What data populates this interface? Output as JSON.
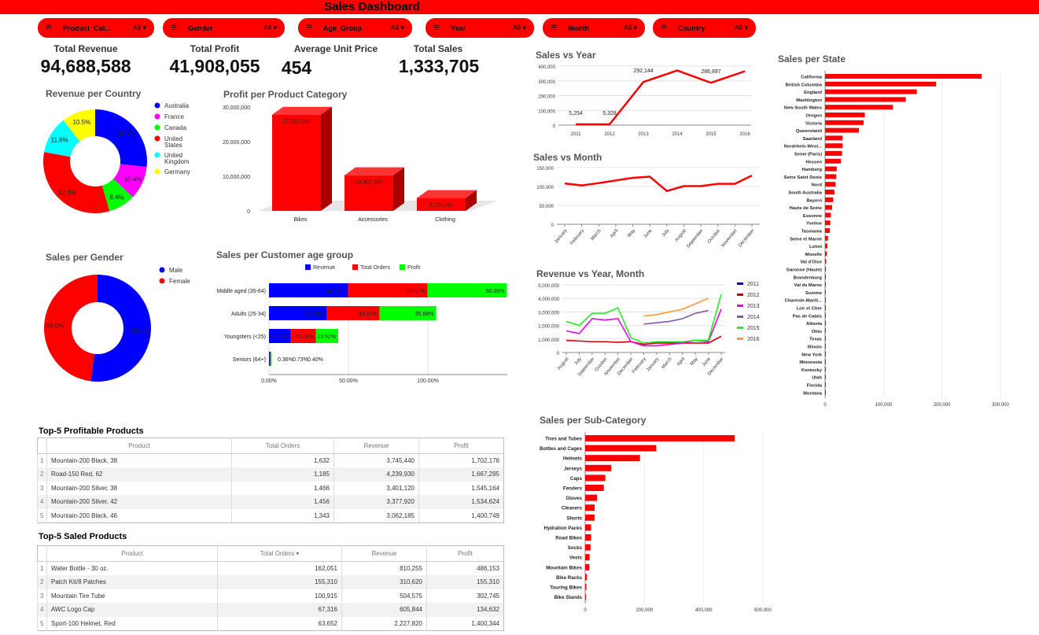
{
  "header": {
    "title": "Sales Dashboard"
  },
  "filters": [
    {
      "name": "Product_Cat...",
      "value": "All"
    },
    {
      "name": "Gender",
      "value": "All"
    },
    {
      "name": "Age_Group",
      "value": "All"
    },
    {
      "name": "Year",
      "value": "All"
    },
    {
      "name": "Month",
      "value": "All"
    },
    {
      "name": "Country",
      "value": "All"
    }
  ],
  "kpis": [
    {
      "label": "Total Revenue",
      "value": "94,688,588"
    },
    {
      "label": "Total Profit",
      "value": "41,908,055"
    },
    {
      "label": "Average Unit Price",
      "value": "454"
    },
    {
      "label": "Total Sales",
      "value": "1,333,705"
    }
  ],
  "sections": {
    "revenue_country": "Revenue per Country",
    "profit_category": "Profit per Product Category",
    "sales_gender": "Sales per Gender",
    "sales_age": "Sales per Customer age group",
    "sales_year": "Sales vs Year",
    "sales_month": "Sales vs Month",
    "rev_year_month": "Revenue vs Year, Month",
    "sales_state": "Sales per State",
    "sales_subcat": "Sales per Sub-Category",
    "top_profitable": "Top-5 Profitable Products",
    "top_saled": "Top-5 Saled Products"
  },
  "chart_data": [
    {
      "id": "revenue_country",
      "type": "pie",
      "title": "Revenue per Country",
      "labels": [
        "Australia",
        "France",
        "Canada",
        "United States",
        "United Kingdom",
        "Germany"
      ],
      "values": [
        26.7,
        10.4,
        8.4,
        32.3,
        11.6,
        10.5
      ],
      "colors": [
        "#0000ff",
        "#ff00ff",
        "#00ff00",
        "#ff0000",
        "#00ffff",
        "#ffff00"
      ],
      "slice_labels": [
        "26.7%",
        "10.4%",
        "8.4%",
        "32.3%",
        "11.6%",
        "10.5%"
      ],
      "legend_lines": [
        [
          "Australia"
        ],
        [
          "France"
        ],
        [
          "Canada"
        ],
        [
          "United",
          "States"
        ],
        [
          "United",
          "Kingdom"
        ],
        [
          "Germany"
        ]
      ]
    },
    {
      "id": "profit_category",
      "type": "bar",
      "title": "Profit per Product Category",
      "categories": [
        "Bikes",
        "Accessories",
        "Clothing"
      ],
      "values": [
        27793169,
        10301205,
        3723681
      ],
      "data_labels": [
        "27,793,169",
        "10,301,205",
        "3,723,681"
      ],
      "y_ticks": [
        "30,000,000",
        "20,000,000",
        "10,000,000",
        "0"
      ],
      "ylim": [
        0,
        30000000
      ]
    },
    {
      "id": "sales_gender",
      "type": "pie",
      "title": "Sales per Gender",
      "labels": [
        "Male",
        "Female"
      ],
      "values": [
        52,
        48
      ],
      "colors": [
        "#0000ff",
        "#ff0000"
      ],
      "slice_labels": [
        "52.0%",
        "48.0%"
      ]
    },
    {
      "id": "sales_age",
      "type": "bar",
      "title": "Sales per Customer age group",
      "categories": [
        "Middle aged (35-64)",
        "Adults (25-34)",
        "Youngsters (<25)",
        "Seniors (64+)"
      ],
      "series": [
        {
          "name": "Revenue",
          "color": "#0000ff",
          "values": [
            49.72,
            36.33,
            13.58,
            0.36
          ],
          "labels": [
            "49.72%",
            "36.33%",
            "13.58%",
            "0.36%"
          ]
        },
        {
          "name": "Total Orders",
          "color": "#ff0000",
          "values": [
            50.02,
            33.21,
            16.04,
            0.73
          ],
          "labels": [
            "50.02%",
            "33.21%",
            "16.04%",
            "0.73%"
          ]
        },
        {
          "name": "Profit",
          "color": "#00ff00",
          "values": [
            50.0,
            35.68,
            13.92,
            0.4
          ],
          "labels": [
            "50.00%",
            "35.68%",
            "13.92%",
            "0.40%"
          ]
        }
      ],
      "x_ticks": [
        "0.00%",
        "50.00%",
        "100.00%"
      ],
      "xlim": [
        0,
        150
      ]
    },
    {
      "id": "sales_year",
      "type": "line",
      "title": "Sales vs Year",
      "x": [
        "2011",
        "2012",
        "2013",
        "2014",
        "2015",
        "2016"
      ],
      "values": [
        5254,
        5328,
        292144,
        370000,
        286897,
        365000
      ],
      "data_labels": [
        "5,254",
        "5,328",
        "292,144",
        "",
        "286,897",
        ""
      ],
      "y_ticks": [
        "400,000",
        "300,000",
        "200,000",
        "100,000",
        "0"
      ],
      "ylim": [
        0,
        400000
      ],
      "color": "#ff0000"
    },
    {
      "id": "sales_month",
      "type": "line",
      "title": "Sales vs Month",
      "x": [
        "January",
        "February",
        "March",
        "April",
        "May",
        "June",
        "July",
        "August",
        "September",
        "October",
        "November",
        "December"
      ],
      "values": [
        108000,
        103000,
        109000,
        116000,
        123000,
        126000,
        88000,
        101000,
        101000,
        107000,
        107000,
        129000
      ],
      "y_ticks": [
        "150,000",
        "100,000",
        "50,000",
        "0"
      ],
      "ylim": [
        0,
        150000
      ],
      "color": "#ff0000"
    },
    {
      "id": "rev_year_month",
      "type": "line",
      "title": "Revenue vs Year, Month",
      "x": [
        "August",
        "July",
        "September",
        "October",
        "November",
        "December",
        "February",
        "January",
        "March",
        "April",
        "May",
        "June",
        "December"
      ],
      "y_ticks": [
        "5,000,000",
        "4,000,000",
        "3,000,000",
        "2,000,000",
        "1,000,000",
        "0"
      ],
      "ylim": [
        0,
        5000000
      ],
      "series": [
        {
          "name": "2011",
          "color": "#0000cc",
          "values": [
            null,
            null,
            null,
            null,
            null,
            null,
            null,
            null,
            null,
            null,
            null,
            null,
            null
          ]
        },
        {
          "name": "2012",
          "color": "#cc0000",
          "values": [
            900000,
            850000,
            800000,
            800000,
            750000,
            800000,
            600000,
            700000,
            700000,
            700000,
            700000,
            700000,
            1200000
          ]
        },
        {
          "name": "2013",
          "color": "#ee00ee",
          "values": [
            1600000,
            1400000,
            2500000,
            2400000,
            2500000,
            800000,
            500000,
            500000,
            600000,
            700000,
            900000,
            800000,
            3200000
          ]
        },
        {
          "name": "2014",
          "color": "#8855aa",
          "values": [
            null,
            null,
            null,
            null,
            null,
            null,
            2100000,
            2200000,
            2300000,
            2500000,
            2900000,
            3100000,
            null
          ]
        },
        {
          "name": "2015",
          "color": "#22ee22",
          "values": [
            2300000,
            2000000,
            2900000,
            2900000,
            3300000,
            1100000,
            700000,
            800000,
            800000,
            800000,
            900000,
            900000,
            4300000
          ]
        },
        {
          "name": "2016",
          "color": "#ff9933",
          "values": [
            null,
            null,
            null,
            null,
            null,
            null,
            2700000,
            2800000,
            3000000,
            3200000,
            3600000,
            4000000,
            null
          ]
        }
      ]
    },
    {
      "id": "sales_state",
      "type": "bar",
      "title": "Sales per State",
      "categories": [
        "California",
        "British Columbia",
        "England",
        "Washington",
        "New South Wales",
        "Oregon",
        "Victoria",
        "Queensland",
        "Saarland",
        "Nordrhein-West...",
        "Seine (Paris)",
        "Hessen",
        "Hamburg",
        "Seine Saint Denis",
        "Nord",
        "South Australia",
        "Bayern",
        "Hauts de Seine",
        "Essonne",
        "Yveline",
        "Tasmania",
        "Seine et Marne",
        "Loiret",
        "Moselle",
        "Val d'Oise",
        "Garonne (Haute)",
        "Brandenburg",
        "Val de Marne",
        "Somme",
        "Charente-Mariti...",
        "Loir et Cher",
        "Pas de Calais",
        "Alberta",
        "Ohio",
        "Texas",
        "Illinois",
        "New York",
        "Minnesota",
        "Kentucky",
        "Utah",
        "Florida",
        "Montana"
      ],
      "values": [
        268000,
        190000,
        157000,
        138000,
        116000,
        68000,
        66000,
        58000,
        30000,
        30000,
        29000,
        27000,
        20000,
        19000,
        18000,
        16000,
        14000,
        12000,
        10000,
        9000,
        8000,
        5000,
        4000,
        3000,
        2000,
        1500,
        1200,
        1100,
        1000,
        900,
        800,
        700,
        400,
        300,
        300,
        200,
        200,
        200,
        150,
        150,
        100,
        100
      ],
      "x_ticks": [
        "0",
        "100,000",
        "200,000",
        "300,000"
      ],
      "xlim": [
        0,
        300000
      ],
      "color": "#ff0000"
    },
    {
      "id": "sales_subcat",
      "type": "bar",
      "title": "Sales per Sub-Category",
      "categories": [
        "Tires and Tubes",
        "Bottles and Cages",
        "Helmets",
        "Jerseys",
        "Caps",
        "Fenders",
        "Gloves",
        "Cleaners",
        "Shorts",
        "Hydration Packs",
        "Road Bikes",
        "Socks",
        "Vests",
        "Mountain Bikes",
        "Bike Racks",
        "Touring Bikes",
        "Bike Stands"
      ],
      "values": [
        505000,
        240000,
        185000,
        88000,
        68000,
        63000,
        40000,
        32000,
        32000,
        20000,
        20000,
        18000,
        15000,
        14000,
        6000,
        4000,
        2000
      ],
      "x_ticks": [
        "0",
        "200,000",
        "400,000",
        "600,000"
      ],
      "xlim": [
        0,
        600000
      ],
      "color": "#ff0000"
    }
  ],
  "tables": {
    "profitable": {
      "columns": [
        "Product",
        "Total Orders",
        "Revenue",
        "Profit"
      ],
      "rows": [
        [
          "1",
          "Mountain-200 Black, 38",
          "1,632",
          "3,745,440",
          "1,702,176"
        ],
        [
          "2",
          "Road-150 Red, 62",
          "1,185",
          "4,239,930",
          "1,667,295"
        ],
        [
          "3",
          "Mountain-200 Silver, 38",
          "1,466",
          "3,401,120",
          "1,545,164"
        ],
        [
          "4",
          "Mountain-200 Silver, 42",
          "1,456",
          "3,377,920",
          "1,534,624"
        ],
        [
          "5",
          "Mountain-200 Black, 46",
          "1,343",
          "3,062,185",
          "1,400,749"
        ]
      ]
    },
    "saled": {
      "columns": [
        "Product",
        "Total Orders",
        "Revenue",
        "Profit"
      ],
      "rows": [
        [
          "1",
          "Water Bottle - 30 oz.",
          "162,051",
          "810,255",
          "486,153"
        ],
        [
          "2",
          "Patch Kit/8 Patches",
          "155,310",
          "310,620",
          "155,310"
        ],
        [
          "3",
          "Mountain Tire Tube",
          "100,915",
          "504,575",
          "302,745"
        ],
        [
          "4",
          "AWC Logo Cap",
          "67,316",
          "605,844",
          "134,632"
        ],
        [
          "5",
          "Sport-100 Helmet, Red",
          "63,652",
          "2,227,820",
          "1,400,344"
        ]
      ]
    }
  }
}
